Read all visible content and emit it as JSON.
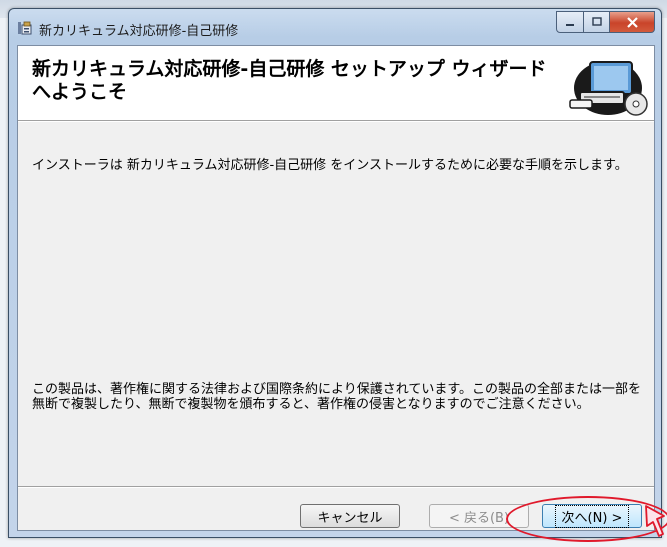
{
  "window": {
    "title": "新カリキュラム対応研修-自己研修"
  },
  "header": {
    "title": "新カリキュラム対応研修-自己研修 セットアップ ウィザードへようこそ"
  },
  "body": {
    "intro": "インストーラは 新カリキュラム対応研修-自己研修 をインストールするために必要な手順を示します。",
    "copyright": "この製品は、著作権に関する法律および国際条約により保護されています。この製品の全部または一部を無断で複製したり、無断で複製物を頒布すると、著作権の侵害となりますのでご注意ください。"
  },
  "buttons": {
    "cancel": "キャンセル",
    "back": "< 戻る(B)",
    "next": "次へ(N) >"
  },
  "colors": {
    "titlebar": "#b7cde6",
    "close_button": "#c9442a",
    "highlight_annotation": "#e0192b"
  },
  "icons": [
    "installer-app-icon",
    "minimize-icon",
    "maximize-icon",
    "close-icon",
    "computer-setup-icon",
    "mouse-pointer-icon"
  ]
}
